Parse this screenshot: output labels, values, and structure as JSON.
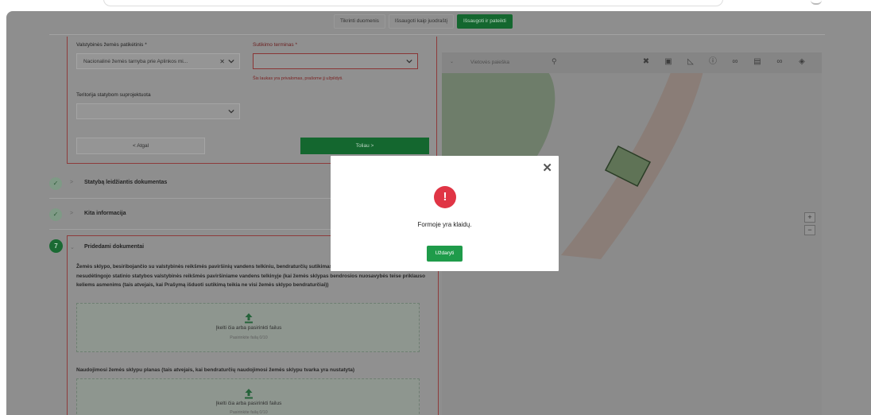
{
  "toolbar": {
    "check_data": "Tikrinti duomenis",
    "save_draft": "Išsaugoti kaip juodraštį",
    "save_submit": "Išsaugoti ir pateikti"
  },
  "form": {
    "owner_label": "Valstybinės žemės patikėtinis *",
    "owner_value": "Nacionalinė žemės tarnyba prie Aplinkos mi...",
    "consent_label": "Sutikimo terminas *",
    "consent_value": "",
    "consent_error": "Šis laukas yra privalomas, prašome jį užpildyti.",
    "territory_label": "Teritorija statybom suprojektuota",
    "territory_value": "",
    "back_button": "< Atgal",
    "next_button": "Toliau >"
  },
  "sections": {
    "building_permit": "Statybą leidžiantis dokumentas",
    "other_info": "Kita informacija",
    "attached_docs": "Pridedami dokumentai",
    "attached_docs_number": "7"
  },
  "docs": {
    "description": "Žemės sklypo, besiribojančio su valstybinės reikšmės paviršinių vandens telkiniu, bendraturčių sutikimas, kai planuojamo laikinojo nesudėtingojo statinio statybos valstybinės reikšmės paviršiniame vandens telkinyje (kai žemės sklypas bendrosios nuosavybės teise priklauso keliems asmenims (tais atvejais, kai Prašymą išduoti sutikimą teikia ne visi žemės sklypo bendraturčiai))",
    "dropzone_text": "Įkelti čia arba pasirinkti failus",
    "dropzone_sub": "Pasirinkite failą 0/10",
    "plan_label": "Naudojimosi žemės sklypu planas (tais atvejais, kai bendraturčių naudojimosi žemės sklypu tvarka yra nustatyta)",
    "dropzone2_text": "Įkelti čia arba pasirinkti failus",
    "dropzone2_sub": "Pasirinkite failą 0/10"
  },
  "map": {
    "search_placeholder": "Vietovės paieška",
    "zoom_in": "+",
    "zoom_out": "−",
    "tools": [
      "crosshair-icon",
      "document-icon",
      "ruler-icon",
      "info-icon",
      "link-search-icon",
      "file-icon",
      "chain-link-icon",
      "layers-icon"
    ]
  },
  "modal": {
    "message": "Formoje yra klaidų.",
    "close_button": "Uždaryti",
    "icon_glyph": "!",
    "close_glyph": "✕"
  },
  "colors": {
    "primary_green": "#1f9b4a",
    "error_red": "#e03545"
  }
}
